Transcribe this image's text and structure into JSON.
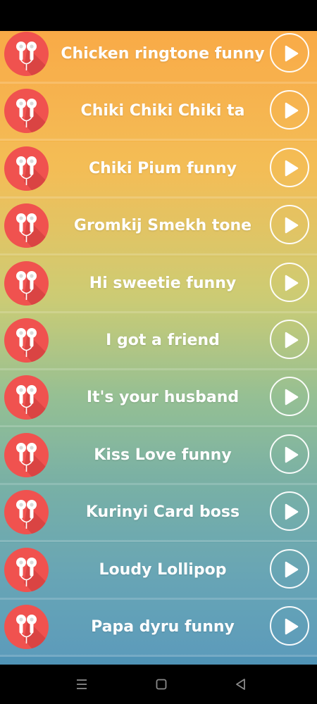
{
  "ringtones": [
    {
      "title": "Chicken ringtone funny"
    },
    {
      "title": "Chiki Chiki Chiki ta"
    },
    {
      "title": "Chiki Pium funny"
    },
    {
      "title": "Gromkij Smekh tone"
    },
    {
      "title": "Hi sweetie funny"
    },
    {
      "title": "I got a friend"
    },
    {
      "title": "It's your husband"
    },
    {
      "title": "Kiss Love funny"
    },
    {
      "title": "Kurinyi Card boss"
    },
    {
      "title": "Loudy Lollipop"
    },
    {
      "title": "Papa dyru funny"
    }
  ],
  "colors": {
    "icon_red": "#f0524f",
    "gradient_top": "#f9a43a",
    "gradient_bottom": "#4f93b6"
  },
  "icons": {
    "row_icon": "earbuds-icon",
    "play": "play-icon",
    "nav_menu": "menu-icon",
    "nav_home": "home-square-icon",
    "nav_back": "back-triangle-icon"
  }
}
